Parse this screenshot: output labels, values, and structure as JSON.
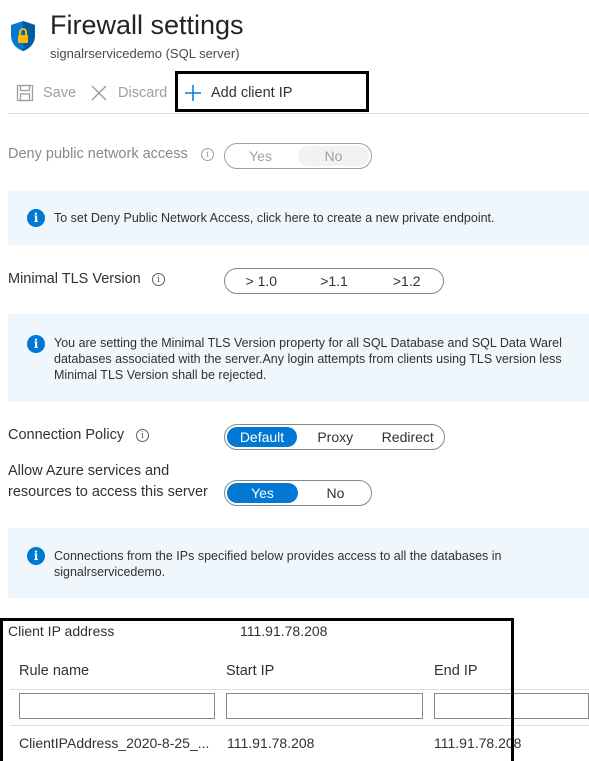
{
  "header": {
    "title": "Firewall settings",
    "subtitle": "signalrservicedemo (SQL server)"
  },
  "toolbar": {
    "save_label": "Save",
    "discard_label": "Discard",
    "add_client_ip_label": "Add client IP"
  },
  "deny_public": {
    "label": "Deny public network access",
    "options": [
      "Yes",
      "No"
    ],
    "selected": "No"
  },
  "info_private_endpoint": "To set Deny Public Network Access, click here to create a new private endpoint.",
  "tls": {
    "label": "Minimal TLS Version",
    "options": [
      "> 1.0",
      ">1.1",
      ">1.2"
    ]
  },
  "info_tls": {
    "line1": "You are setting the Minimal TLS Version property for all SQL Database and SQL Data Warel",
    "line2": "databases associated with the server.Any login attempts from clients using TLS version less",
    "line3": "Minimal TLS Version shall be rejected."
  },
  "connection_policy": {
    "label": "Connection Policy",
    "options": [
      "Default",
      "Proxy",
      "Redirect"
    ],
    "selected": "Default"
  },
  "allow_azure": {
    "label_line1": "Allow Azure services and",
    "label_line2": "resources to access this server",
    "options": [
      "Yes",
      "No"
    ],
    "selected": "Yes"
  },
  "info_connections": {
    "line1": "Connections from the IPs specified below provides access to all the databases in",
    "line2": "signalrservicedemo."
  },
  "client_ip": {
    "label": "Client IP address",
    "value": "111.91.78.208"
  },
  "rules_table": {
    "headers": [
      "Rule name",
      "Start IP",
      "End IP"
    ],
    "rows": [
      {
        "rule_name": "ClientIPAddress_2020-8-25_...",
        "start_ip": "111.91.78.208",
        "end_ip": "111.91.78.208"
      }
    ]
  },
  "colors": {
    "accent": "#0078d4",
    "info_bg": "#eff6fc",
    "highlight_border": "#000000"
  },
  "icons": [
    "shield-icon",
    "save-icon",
    "discard-icon",
    "plus-icon",
    "info-icon"
  ]
}
